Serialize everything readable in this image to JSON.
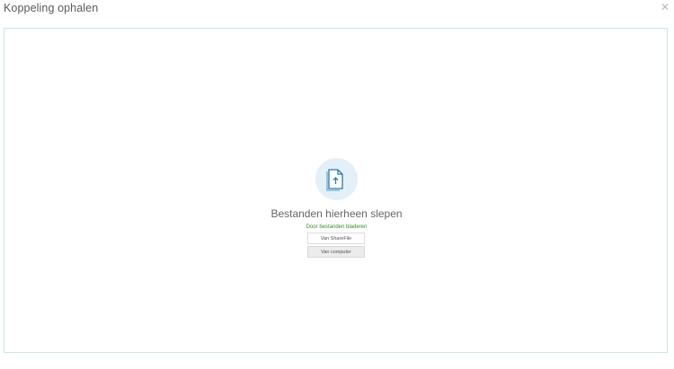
{
  "dialog": {
    "title": "Koppeling ophalen",
    "close_icon": "close-icon"
  },
  "dropzone": {
    "icon": "file-upload-icon",
    "drop_text": "Bestanden hierheen slepen",
    "browse_text": "Door bestanden bladeren",
    "buttons": {
      "sharefile": "Van ShareFile",
      "computer": "Van computer"
    }
  },
  "colors": {
    "accent_green": "#3c8a2e",
    "icon_blue": "#2a7ab0",
    "circle_bg": "#e4f0f8",
    "border": "#cfe3ea"
  }
}
